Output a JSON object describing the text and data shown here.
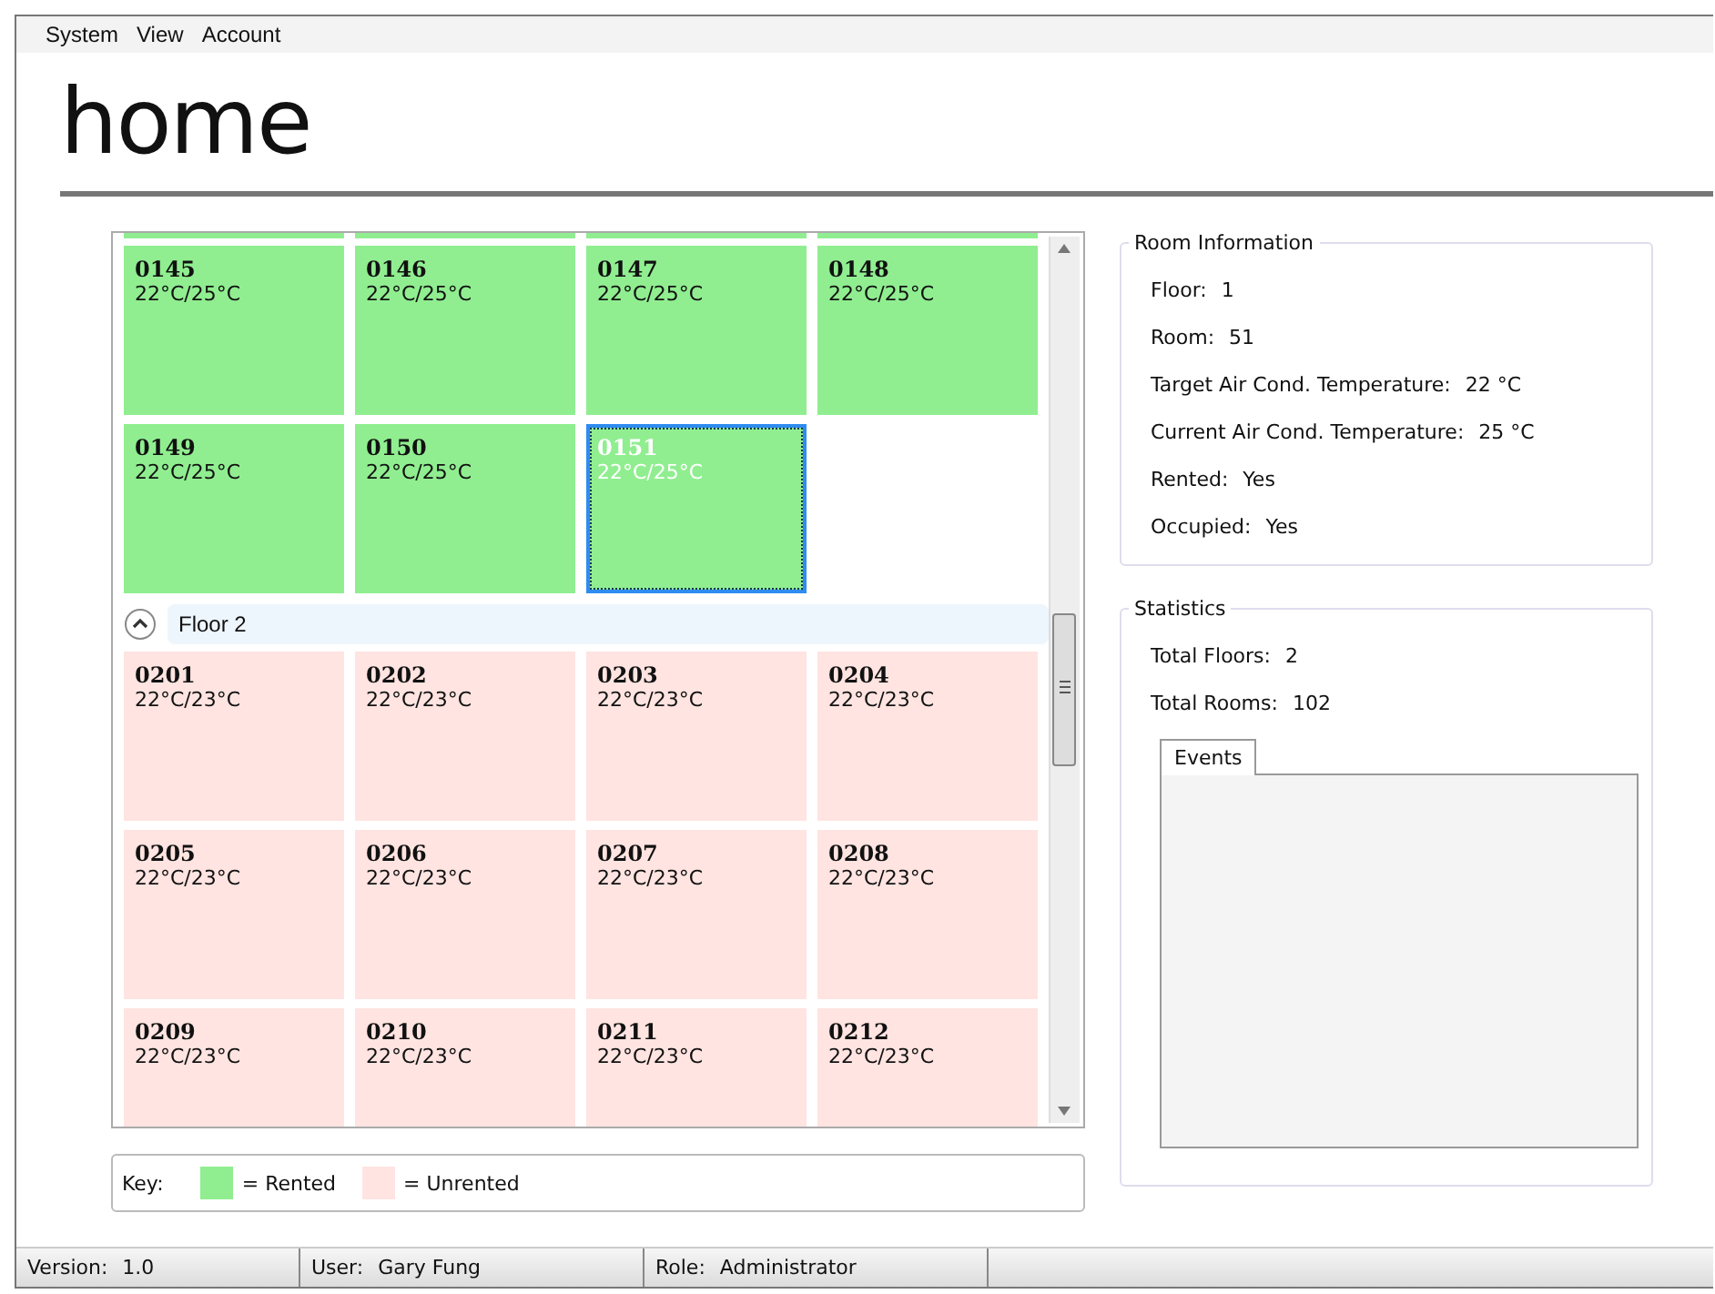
{
  "menu": [
    {
      "label": "System"
    },
    {
      "label": "View"
    },
    {
      "label": "Account"
    }
  ],
  "title": "home",
  "room_grid": {
    "sections": [
      {
        "rooms": [
          {
            "number": "0145",
            "temps": "22°C/25°C",
            "rented": true,
            "selected": false
          },
          {
            "number": "0146",
            "temps": "22°C/25°C",
            "rented": true,
            "selected": false
          },
          {
            "number": "0147",
            "temps": "22°C/25°C",
            "rented": true,
            "selected": false
          },
          {
            "number": "0148",
            "temps": "22°C/25°C",
            "rented": true,
            "selected": false
          },
          {
            "number": "0149",
            "temps": "22°C/25°C",
            "rented": true,
            "selected": false
          },
          {
            "number": "0150",
            "temps": "22°C/25°C",
            "rented": true,
            "selected": false
          },
          {
            "number": "0151",
            "temps": "22°C/25°C",
            "rented": true,
            "selected": true
          }
        ]
      },
      {
        "header": "Floor 2",
        "expanded": true,
        "rooms": [
          {
            "number": "0201",
            "temps": "22°C/23°C",
            "rented": false,
            "selected": false
          },
          {
            "number": "0202",
            "temps": "22°C/23°C",
            "rented": false,
            "selected": false
          },
          {
            "number": "0203",
            "temps": "22°C/23°C",
            "rented": false,
            "selected": false
          },
          {
            "number": "0204",
            "temps": "22°C/23°C",
            "rented": false,
            "selected": false
          },
          {
            "number": "0205",
            "temps": "22°C/23°C",
            "rented": false,
            "selected": false
          },
          {
            "number": "0206",
            "temps": "22°C/23°C",
            "rented": false,
            "selected": false
          },
          {
            "number": "0207",
            "temps": "22°C/23°C",
            "rented": false,
            "selected": false
          },
          {
            "number": "0208",
            "temps": "22°C/23°C",
            "rented": false,
            "selected": false
          },
          {
            "number": "0209",
            "temps": "22°C/23°C",
            "rented": false,
            "selected": false
          },
          {
            "number": "0210",
            "temps": "22°C/23°C",
            "rented": false,
            "selected": false
          },
          {
            "number": "0211",
            "temps": "22°C/23°C",
            "rented": false,
            "selected": false
          },
          {
            "number": "0212",
            "temps": "22°C/23°C",
            "rented": false,
            "selected": false
          }
        ]
      }
    ]
  },
  "key": {
    "label": "Key:",
    "items": [
      {
        "rented": true,
        "label": "= Rented"
      },
      {
        "rented": false,
        "label": "= Unrented"
      }
    ]
  },
  "room_information": {
    "title": "Room Information",
    "fields": [
      {
        "label": "Floor:",
        "value": "1"
      },
      {
        "label": "Room:",
        "value": "51"
      },
      {
        "label": "Target Air Cond. Temperature:",
        "value": "22 °C"
      },
      {
        "label": "Current Air Cond. Temperature:",
        "value": "25 °C"
      },
      {
        "label": "Rented:",
        "value": "Yes"
      },
      {
        "label": "Occupied:",
        "value": "Yes"
      }
    ]
  },
  "statistics": {
    "title": "Statistics",
    "fields": [
      {
        "label": "Total Floors:",
        "value": "2"
      },
      {
        "label": "Total Rooms:",
        "value": "102"
      }
    ],
    "tabs": [
      {
        "label": "Events",
        "selected": true
      }
    ]
  },
  "status_bar": [
    {
      "label": "Version:",
      "value": "1.0"
    },
    {
      "label": "User:",
      "value": "Gary Fung"
    },
    {
      "label": "Role:",
      "value": "Administrator"
    }
  ]
}
